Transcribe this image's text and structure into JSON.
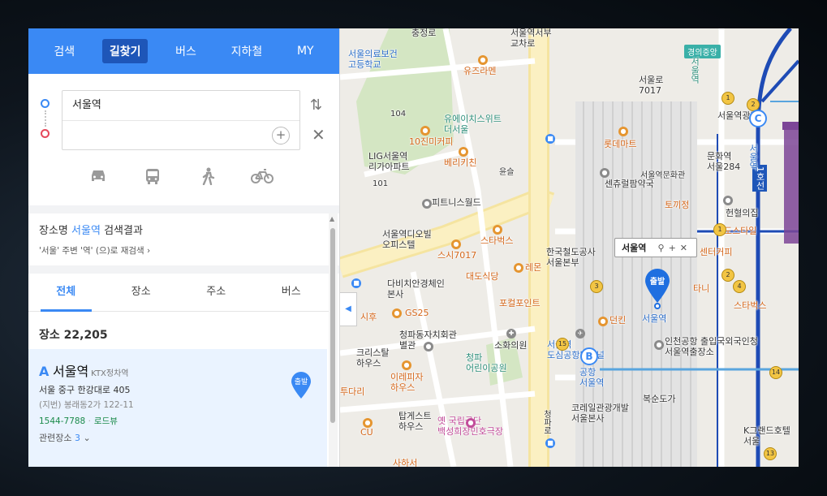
{
  "nav": {
    "tabs": [
      "검색",
      "길찾기",
      "버스",
      "지하철",
      "MY"
    ],
    "active": 1
  },
  "route": {
    "start": "서울역",
    "end": ""
  },
  "modes": [
    "car-icon",
    "bus-icon",
    "walk-icon",
    "bike-icon"
  ],
  "search": {
    "prefix": "장소명",
    "query": "서울역",
    "suffix": "검색결과",
    "research": "'서울' 주변 '역' (으)로 재검색"
  },
  "result_tabs": [
    "전체",
    "장소",
    "주소",
    "버스"
  ],
  "count": {
    "label": "장소",
    "value": "22,205"
  },
  "result": {
    "letter": "A",
    "name": "서울역",
    "category": "KTX정차역",
    "address": "서울 중구 한강대로 405",
    "jibun": "(지번) 봉래동2가 122-11",
    "tel": "1544-7788",
    "roadview": "로드뷰",
    "related": "관련장소",
    "related_count": "3",
    "pin_label": "출발"
  },
  "map": {
    "popup_title": "서울역",
    "start_pin": "출발",
    "labels": {
      "l1": "서울의료보건\n고등학교",
      "l2": "유즈라멘",
      "l3": "충정로",
      "l4": "서울역서부\n교차로",
      "l5": "104",
      "l6": "유에이치스위트\n더서울",
      "l7": "10진미커피",
      "l8": "LIG서울역\n리가아파트",
      "l9": "101",
      "l10": "베리키친",
      "l11": "윤슬",
      "l12": "피트니스월드",
      "l13": "서울역디오빌\n오피스텔",
      "l14": "스타벅스",
      "l15": "스시7017",
      "l16": "다비치안경체인\n본사",
      "l17": "대도식당",
      "l18": "레몬",
      "l19": "포컬포인트",
      "l20": "한국철도공사\n서울본부",
      "l21": "시후",
      "l22": "GS25",
      "l23": "청파동자치회관\n별관",
      "l24": "소화의원",
      "l25": "크리스탈\n하우스",
      "l26": "이레피자\n하우스",
      "l27": "청파\n어린이공원",
      "l28": "투다리",
      "l29": "탑게스트\n하우스",
      "l30": "CU",
      "l31": "옛 국립극단\n백성희장민호극장",
      "l32": "서울로\n7017",
      "l33": "롯데마트",
      "l34": "센츄럴팜약국",
      "l35": "서울역문화관",
      "l36": "토끼정",
      "l37": "헌혈의집",
      "l38": "도스타일",
      "l39": "센터커피",
      "l40": "타니",
      "l41": "스타벅스",
      "l42": "던킨",
      "l43": "서울역",
      "l44": "인천공항 출입국외국인청\n서울역출장소",
      "l45": "문화역\n서울284",
      "l46": "서울역광장",
      "l47": "서울역\n도심공항터미널",
      "l48": "코레일관광개발\n서울본사",
      "l49": "복순도가",
      "l50": "K그랜드호텔\n서울",
      "l51": "사하서",
      "l52": "경의중앙",
      "l53": "서울역",
      "l54": "1호선",
      "l55": "공항\n서울역",
      "l56": "청파로",
      "l57": "서울역"
    },
    "stations": {
      "c": "C",
      "b": "B"
    },
    "exits": [
      "1",
      "2",
      "3",
      "1",
      "2",
      "4",
      "15",
      "14",
      "13"
    ]
  }
}
